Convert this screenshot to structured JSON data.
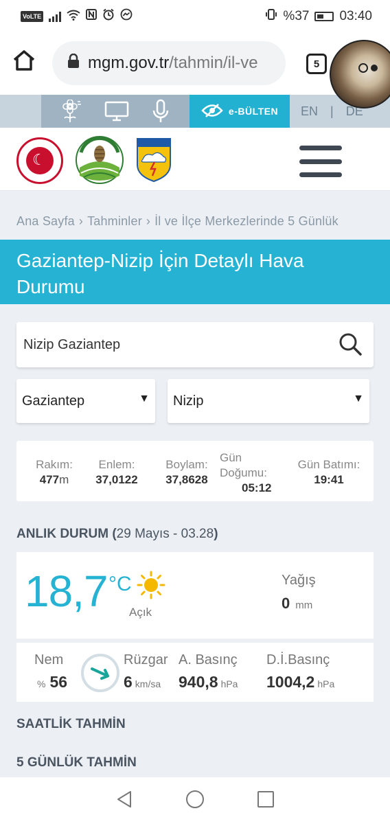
{
  "status_bar": {
    "volte": "VoLTE",
    "battery": "%37",
    "time": "03:40"
  },
  "browser": {
    "url_domain": "mgm.gov.tr",
    "url_path": "/tahmin/il-ve",
    "tab_count": "5"
  },
  "site_toolbar": {
    "ebulten_label": "e-BÜLTEN",
    "lang_en": "EN",
    "lang_sep": "|",
    "lang_de": "DE"
  },
  "breadcrumb": [
    "Ana Sayfa",
    "Tahminler",
    "İl ve İlçe Merkezlerinde 5 Günlük"
  ],
  "title": {
    "place": "Gaziantep-Nizip",
    "rest_line1": " İçin Detaylı Hava",
    "rest_line2": "Durumu"
  },
  "search": {
    "value": "Nizip Gaziantep"
  },
  "selects": {
    "il": "Gaziantep",
    "ilce": "Nizip"
  },
  "info": {
    "rakim_label": "Rakım:",
    "rakim_value": "477",
    "rakim_unit": "m",
    "enlem_label": "Enlem:",
    "enlem_value": "37,0122",
    "boylam_label": "Boylam:",
    "boylam_value": "37,8628",
    "gundogumu_label_1": "Gün",
    "gundogumu_label_2": "Doğumu:",
    "gundogumu_value": "05:12",
    "gunbatimi_label": "Gün Batımı:",
    "gunbatimi_value": "19:41"
  },
  "anlik": {
    "title": "ANLIK DURUM (",
    "date": "29 Mayıs - 03.28",
    "close": ")",
    "temperature": "18,7",
    "temp_unit": "°C",
    "condition": "Açık",
    "yagis_label": "Yağış",
    "yagis_value": "0",
    "yagis_unit": "mm",
    "nem_label": "Nem",
    "nem_prefix": "%",
    "nem_value": "56",
    "ruzgar_label": "Rüzgar",
    "ruzgar_value": "6",
    "ruzgar_unit": "km/sa",
    "abasinc_label": "A. Basınç",
    "abasinc_value": "940,8",
    "abasinc_unit": "hPa",
    "dibasinc_label": "D.İ.Basınç",
    "dibasinc_value": "1004,2",
    "dibasinc_unit": "hPa"
  },
  "sections": {
    "saatlik": "SAATLİK TAHMİN",
    "gunluk": "5 GÜNLÜK TAHMİN"
  },
  "colors": {
    "accent": "#25b2d3",
    "page_bg": "#ecf0f4",
    "toolbar_bg": "#c7d4de"
  }
}
